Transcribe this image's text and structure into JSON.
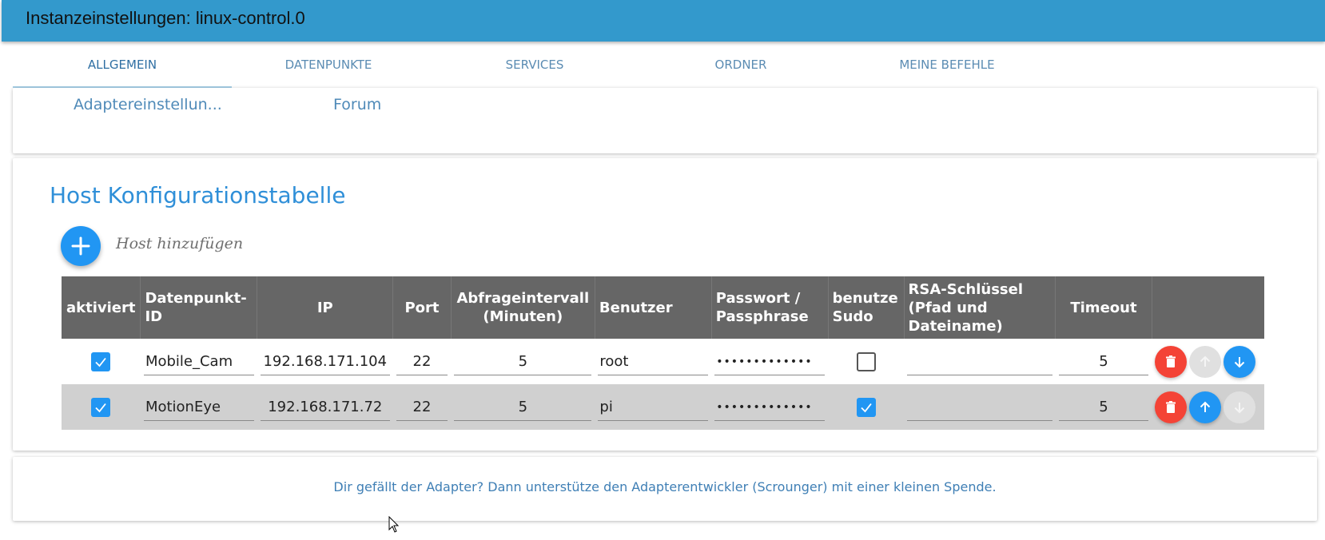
{
  "titlebar": {
    "title": "Instanzeinstellungen: linux-control.0"
  },
  "tabs": [
    {
      "label": "ALLGEMEIN",
      "active": true
    },
    {
      "label": "DATENPUNKTE",
      "active": false
    },
    {
      "label": "SERVICES",
      "active": false
    },
    {
      "label": "ORDNER",
      "active": false
    },
    {
      "label": "MEINE BEFEHLE",
      "active": false
    }
  ],
  "links": [
    {
      "label": "Adaptereinstellun..."
    },
    {
      "label": "Forum"
    }
  ],
  "hosts_section": {
    "title": "Host Konfigurationstabelle",
    "add_label": "Host hinzufügen",
    "add_icon": "plus-icon",
    "columns": [
      {
        "label": "aktiviert"
      },
      {
        "label": "Datenpunkt-ID"
      },
      {
        "label": "IP"
      },
      {
        "label": "Port"
      },
      {
        "label": "Abfrageintervall (Minuten)"
      },
      {
        "label": "Benutzer"
      },
      {
        "label": "Passwort / Passphrase"
      },
      {
        "label": "benutze Sudo"
      },
      {
        "label": "RSA-Schlüssel (Pfad und Dateiname)"
      },
      {
        "label": "Timeout"
      },
      {
        "label": ""
      }
    ],
    "rows": [
      {
        "enabled": true,
        "datapoint_id": "Mobile_Cam",
        "ip": "192.168.171.104",
        "port": "22",
        "interval": "5",
        "user": "root",
        "password": "•••••••••••••",
        "sudo": false,
        "rsa_key": "",
        "timeout": "5",
        "actions": {
          "delete": "enabled",
          "up": "disabled",
          "down": "enabled"
        }
      },
      {
        "enabled": true,
        "datapoint_id": "MotionEye",
        "ip": "192.168.171.72",
        "port": "22",
        "interval": "5",
        "user": "pi",
        "password": "•••••••••••••",
        "sudo": true,
        "rsa_key": "",
        "timeout": "5",
        "actions": {
          "delete": "enabled",
          "up": "enabled",
          "down": "disabled"
        }
      }
    ]
  },
  "footer": {
    "text": "Dir gefällt der Adapter? Dann unterstütze den Adapterentwickler (Scrounger) mit einer kleinen Spende."
  },
  "colors": {
    "titlebar": "#3399cc",
    "accent": "#2196f3",
    "danger": "#f44336",
    "table_header": "#666666",
    "row_alt": "#d0d0d0"
  }
}
